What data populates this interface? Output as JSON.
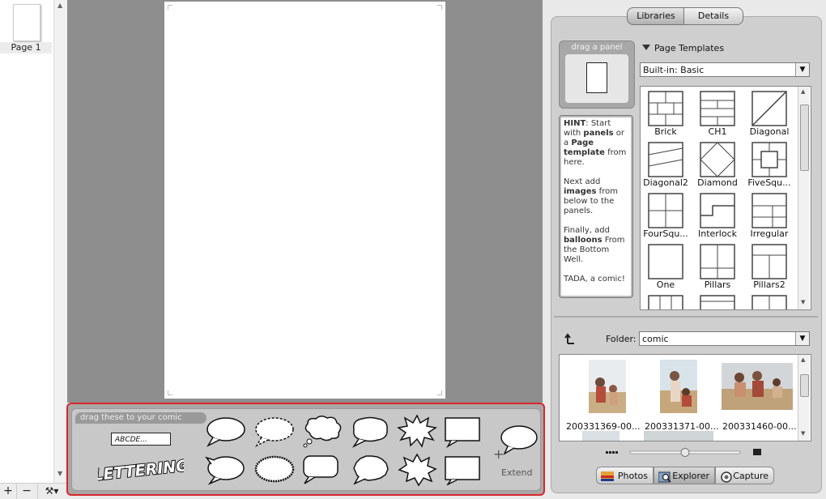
{
  "pages": {
    "items": [
      {
        "label": "Page 1"
      }
    ]
  },
  "bottom_toolbar": {
    "add": "+",
    "remove": "−",
    "tools": "⚒▾"
  },
  "well": {
    "title": "drag these to your comic",
    "lettering_sample": "ABCDE...",
    "lettering_logo": "LETTERING",
    "extend_label": "Extend"
  },
  "right_tabs": {
    "libraries": "Libraries",
    "details": "Details"
  },
  "drag_panel": {
    "label": "drag a panel"
  },
  "hint": {
    "p1": [
      "HINT",
      ": Start with ",
      "panels",
      " or a ",
      "Page template",
      " from here."
    ],
    "p2": [
      "Next add ",
      "images",
      " from below to the panels."
    ],
    "p3": [
      "Finally, add ",
      "balloons",
      " From the Bottom Well."
    ],
    "p4": "TADA, a comic!"
  },
  "templates": {
    "header": "Page Templates",
    "selected": "Built-in: Basic",
    "items": [
      {
        "name": "Brick"
      },
      {
        "name": "CH1"
      },
      {
        "name": "Diagonal"
      },
      {
        "name": "Diagonal2"
      },
      {
        "name": "Diamond"
      },
      {
        "name": "FiveSqu..."
      },
      {
        "name": "FourSqu..."
      },
      {
        "name": "Interlock"
      },
      {
        "name": "Irregular"
      },
      {
        "name": "One"
      },
      {
        "name": "Pillars"
      },
      {
        "name": "Pillars2"
      }
    ]
  },
  "folder": {
    "label": "Folder:",
    "selected": "comic"
  },
  "photos": {
    "items": [
      {
        "name": "200331369-00..."
      },
      {
        "name": "200331371-00..."
      },
      {
        "name": "200331460-00..."
      }
    ]
  },
  "source_tabs": {
    "photos": "Photos",
    "explorer": "Explorer",
    "capture": "Capture"
  }
}
